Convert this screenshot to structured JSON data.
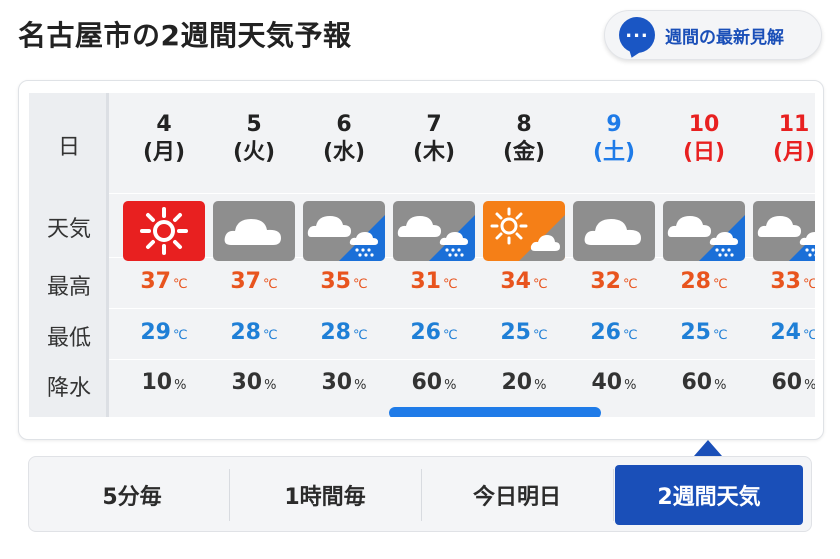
{
  "title": "名古屋市の2週間天気予報",
  "latest_button": {
    "icon": "speech-bubble-icon",
    "glyph": "...",
    "label": "週間の最新見解"
  },
  "row_labels": {
    "date": "日",
    "weather": "天気",
    "high": "最高",
    "low": "最低",
    "rain": "降水"
  },
  "units": {
    "temp": "℃",
    "rain": "%"
  },
  "colors": {
    "weekday": "#222222",
    "saturday": "#1f7be8",
    "sunday": "#e82020",
    "high": "#e8541e",
    "low": "#1f7fd6",
    "accent": "#1a4fb8"
  },
  "days": [
    {
      "day": "4",
      "dow": "(月)",
      "kind": "weekday",
      "weather": "sunny",
      "high": "37",
      "low": "29",
      "rain": "10"
    },
    {
      "day": "5",
      "dow": "(火)",
      "kind": "weekday",
      "weather": "cloudy",
      "high": "37",
      "low": "28",
      "rain": "30"
    },
    {
      "day": "6",
      "dow": "(水)",
      "kind": "weekday",
      "weather": "cloudy-rain",
      "high": "35",
      "low": "28",
      "rain": "30"
    },
    {
      "day": "7",
      "dow": "(木)",
      "kind": "weekday",
      "weather": "cloudy-rain",
      "high": "31",
      "low": "26",
      "rain": "60"
    },
    {
      "day": "8",
      "dow": "(金)",
      "kind": "weekday",
      "weather": "sunny-cloudy",
      "high": "34",
      "low": "25",
      "rain": "20"
    },
    {
      "day": "9",
      "dow": "(土)",
      "kind": "saturday",
      "weather": "cloudy",
      "high": "32",
      "low": "26",
      "rain": "40"
    },
    {
      "day": "10",
      "dow": "(日)",
      "kind": "sunday",
      "weather": "cloudy-rain",
      "high": "28",
      "low": "25",
      "rain": "60"
    },
    {
      "day": "11",
      "dow": "(月)",
      "kind": "sunday",
      "weather": "cloudy-rain",
      "high": "33",
      "low": "24",
      "rain": "60"
    }
  ],
  "tabs": [
    {
      "label": "5分毎",
      "active": false
    },
    {
      "label": "1時間毎",
      "active": false
    },
    {
      "label": "今日明日",
      "active": false
    },
    {
      "label": "2週間天気",
      "active": true
    }
  ]
}
